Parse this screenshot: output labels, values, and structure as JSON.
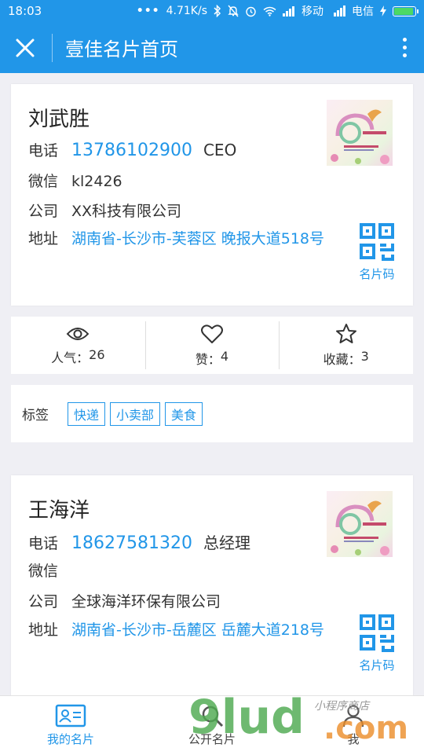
{
  "status_bar": {
    "time": "18:03",
    "dots": "•••",
    "speed": "4.71K/s",
    "carrier1": "移动",
    "carrier2": "电信",
    "net_small": "4G"
  },
  "title_bar": {
    "title": "壹佳名片首页"
  },
  "cards": [
    {
      "name": "刘武胜",
      "phone_label": "电话",
      "phone": "13786102900",
      "role": "CEO",
      "wechat_label": "微信",
      "wechat": "kl2426",
      "company_label": "公司",
      "company": "XX科技有限公司",
      "address_label": "地址",
      "address": "湖南省-长沙市-芙蓉区 晚报大道518号",
      "qr_label": "名片码"
    },
    {
      "name": "王海洋",
      "phone_label": "电话",
      "phone": "18627581320",
      "role": "总经理",
      "wechat_label": "微信",
      "wechat": "",
      "company_label": "公司",
      "company": "全球海洋环保有限公司",
      "address_label": "地址",
      "address": "湖南省-长沙市-岳麓区 岳麓大道218号",
      "qr_label": "名片码"
    }
  ],
  "stats": {
    "views_label": "人气：",
    "views": "26",
    "likes_label": "赞：",
    "likes": "4",
    "favorites_label": "收藏：",
    "favorites": "3"
  },
  "tags": {
    "label": "标签",
    "items": [
      "快递",
      "小卖部",
      "美食"
    ]
  },
  "tab_bar": {
    "items": [
      {
        "label": "我的名片",
        "icon": "card-icon",
        "active": true
      },
      {
        "label": "公开名片",
        "icon": "search-icon",
        "active": false
      },
      {
        "label": "我",
        "icon": "user-icon",
        "active": false
      }
    ]
  },
  "watermark": {
    "main": "9lud",
    "suffix": ".com",
    "handwriting": "小程序商店"
  },
  "colors": {
    "primary": "#2196e8",
    "background": "#efeff4"
  }
}
